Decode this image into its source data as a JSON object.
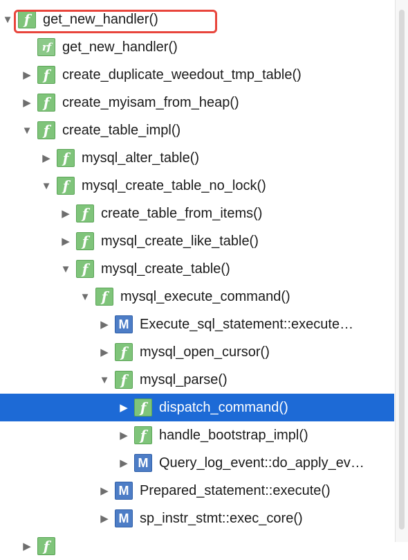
{
  "tree": {
    "items": [
      {
        "label": "get_new_handler()",
        "icon": "function-icon",
        "toggle": "expanded",
        "level": 0
      },
      {
        "label": "get_new_handler()",
        "icon": "ref-function-icon",
        "toggle": "none",
        "level": 1
      },
      {
        "label": "create_duplicate_weedout_tmp_table()",
        "icon": "function-icon",
        "toggle": "collapsed",
        "level": 1
      },
      {
        "label": "create_myisam_from_heap()",
        "icon": "function-icon",
        "toggle": "collapsed",
        "level": 1
      },
      {
        "label": "create_table_impl()",
        "icon": "function-icon",
        "toggle": "expanded",
        "level": 1
      },
      {
        "label": "mysql_alter_table()",
        "icon": "function-icon",
        "toggle": "collapsed",
        "level": 2
      },
      {
        "label": "mysql_create_table_no_lock()",
        "icon": "function-icon",
        "toggle": "expanded",
        "level": 2
      },
      {
        "label": "create_table_from_items()",
        "icon": "function-icon",
        "toggle": "collapsed",
        "level": 3
      },
      {
        "label": "mysql_create_like_table()",
        "icon": "function-icon",
        "toggle": "collapsed",
        "level": 3
      },
      {
        "label": "mysql_create_table()",
        "icon": "function-icon",
        "toggle": "expanded",
        "level": 3
      },
      {
        "label": "mysql_execute_command()",
        "icon": "function-icon",
        "toggle": "expanded",
        "level": 4
      },
      {
        "label": "Execute_sql_statement::execute…",
        "icon": "method-icon",
        "toggle": "collapsed",
        "level": 5
      },
      {
        "label": "mysql_open_cursor()",
        "icon": "function-icon",
        "toggle": "collapsed",
        "level": 5
      },
      {
        "label": "mysql_parse()",
        "icon": "function-icon",
        "toggle": "expanded",
        "level": 5
      },
      {
        "label": "dispatch_command()",
        "icon": "function-icon",
        "toggle": "collapsed",
        "level": 6,
        "selected": true
      },
      {
        "label": "handle_bootstrap_impl()",
        "icon": "function-icon",
        "toggle": "collapsed",
        "level": 6
      },
      {
        "label": "Query_log_event::do_apply_ev…",
        "icon": "method-icon",
        "toggle": "collapsed",
        "level": 6
      },
      {
        "label": "Prepared_statement::execute()",
        "icon": "method-icon",
        "toggle": "collapsed",
        "level": 5
      },
      {
        "label": "sp_instr_stmt::exec_core()",
        "icon": "method-icon",
        "toggle": "collapsed",
        "level": 5
      },
      {
        "label": "",
        "icon": "function-icon",
        "toggle": "collapsed",
        "level": 1
      }
    ]
  },
  "icon_glyphs": {
    "function-icon": "f",
    "ref-function-icon": "rf",
    "method-icon": "M"
  },
  "colors": {
    "selection": "#1d6ad6",
    "function_icon": "#7fc47a",
    "method_icon": "#4d7dc6",
    "annotation_box": "#e8453c"
  }
}
